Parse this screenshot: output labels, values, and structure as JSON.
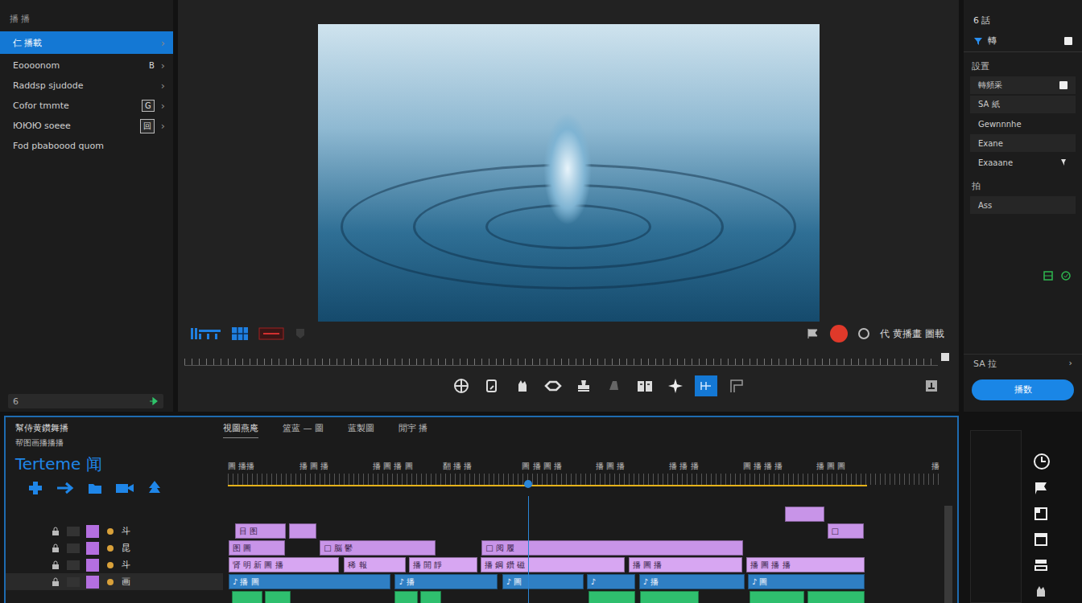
{
  "left_panel": {
    "header": "播  播",
    "items": [
      {
        "label": "仁 播載",
        "selected": true,
        "badge": "",
        "boxed": false,
        "arrow": "›"
      },
      {
        "label": "Eoooonom",
        "selected": false,
        "badge": "B",
        "boxed": false,
        "arrow": "›"
      },
      {
        "label": "Raddsp sjudode",
        "selected": false,
        "badge": "",
        "boxed": false,
        "arrow": "›"
      },
      {
        "label": "Cofor tmmte",
        "selected": false,
        "badge": "G",
        "boxed": true,
        "arrow": "›"
      },
      {
        "label": "ЮЮЮ soeee",
        "selected": false,
        "badge": "回",
        "boxed": true,
        "arrow": "›"
      },
      {
        "label": "Fod pbaboood quom",
        "selected": false,
        "badge": "",
        "boxed": false,
        "arrow": ""
      }
    ],
    "search": {
      "value": "6"
    }
  },
  "preview": {
    "status_label": "代 黄播畫 圖載"
  },
  "tools": [
    {
      "selected": false
    },
    {
      "selected": false
    },
    {
      "selected": false
    },
    {
      "selected": false
    },
    {
      "selected": false
    },
    {
      "selected": false
    },
    {
      "selected": false
    },
    {
      "selected": false
    },
    {
      "selected": true
    },
    {
      "selected": false
    }
  ],
  "right_panel": {
    "title": "6 話",
    "subtitle": "轉",
    "section": "設置",
    "fields": [
      {
        "label": "轉頻采",
        "kind": "field"
      },
      {
        "label": "SA 紙",
        "kind": "field"
      },
      {
        "label": "Gewnnnhe",
        "kind": "plain"
      },
      {
        "label": "Exane",
        "kind": "field"
      },
      {
        "label": "Exaaane",
        "kind": "plain"
      }
    ],
    "section2": "拍",
    "value": "Ass",
    "footer_label": "SA 拉",
    "footer_arrow": "›",
    "button": "播数"
  },
  "timeline": {
    "title": "幫侍黄鑽舞播",
    "subtitle": "帮图画播播播",
    "name": "Terteme 闻",
    "tabs": [
      {
        "label": "視圖燕庵",
        "selected": true
      },
      {
        "label": "篮蓝 — 圖",
        "selected": false
      },
      {
        "label": "蓝製圖",
        "selected": false
      },
      {
        "label": "閒宇 播",
        "selected": false
      }
    ],
    "ruler": {
      "labels": [
        {
          "time": 0,
          "text": "圖 播播"
        },
        {
          "time": 9.7,
          "text": "播 圖 播"
        },
        {
          "time": 19.7,
          "text": "播 圖 播 圖"
        },
        {
          "time": 29.2,
          "text": "翻 播 播"
        },
        {
          "time": 40,
          "text": "圖 播 圖 播"
        },
        {
          "time": 50,
          "text": "播 圖 播"
        },
        {
          "time": 60,
          "text": "播 播 播"
        },
        {
          "time": 70,
          "text": "圖 播 播 播"
        },
        {
          "time": 80,
          "text": "播 圖 圖"
        }
      ],
      "end_label": "播"
    },
    "playhead": 40.8,
    "work_area": {
      "start": 0,
      "end": 86.9
    },
    "tracks": [
      {
        "name": "",
        "selected": false,
        "color": "#c894e8",
        "clips": [
          {
            "start": 75.7,
            "length": 5.6,
            "label": ""
          }
        ]
      },
      {
        "name": "斗",
        "selected": false,
        "color": "#c894e8",
        "clips": [
          {
            "start": 1.0,
            "length": 7.1,
            "label": "目 图"
          },
          {
            "start": 8.3,
            "length": 4.0,
            "label": ""
          },
          {
            "start": 81.5,
            "length": 5.2,
            "label": "□"
          }
        ]
      },
      {
        "name": "昆",
        "selected": false,
        "color": "#c894e8",
        "clips": [
          {
            "start": 0.1,
            "length": 7.9,
            "label": "图 圖"
          },
          {
            "start": 12.5,
            "length": 16.0,
            "label": "□ 脳 鬱"
          },
          {
            "start": 34.5,
            "length": 35.8,
            "label": "□ 阅 履"
          }
        ]
      },
      {
        "name": "斗",
        "selected": false,
        "color": "#d7a6f2",
        "clips": [
          {
            "start": 0.1,
            "length": 15.2,
            "label": "肾 明 新 圖 播"
          },
          {
            "start": 15.8,
            "length": 8.6,
            "label": "稀 報"
          },
          {
            "start": 24.6,
            "length": 9.6,
            "label": "播 開 靜"
          },
          {
            "start": 34.4,
            "length": 19.8,
            "label": "播 鋼 鑽 磁"
          },
          {
            "start": 54.5,
            "length": 15.7,
            "label": "播 圖 播"
          },
          {
            "start": 70.5,
            "length": 16.3,
            "label": "播 圖 播 播"
          }
        ]
      },
      {
        "name": "画",
        "selected": true,
        "color": "#2f7fc4",
        "clips": [
          {
            "start": 0.1,
            "length": 22.2,
            "label": "♪ 播 圖"
          },
          {
            "start": 22.7,
            "length": 14.2,
            "label": "♪ 播"
          },
          {
            "start": 37.3,
            "length": 11.3,
            "label": "♪ 圖"
          },
          {
            "start": 48.8,
            "length": 6.8,
            "label": "♪"
          },
          {
            "start": 55.9,
            "length": 14.6,
            "label": "♪ 播"
          },
          {
            "start": 70.7,
            "length": 16.1,
            "label": "♪ 圖"
          }
        ]
      },
      {
        "name": "",
        "selected": false,
        "color": "#2fbf6e",
        "clips": [
          {
            "start": 0.6,
            "length": 4.3,
            "label": ""
          },
          {
            "start": 5.0,
            "length": 3.8,
            "label": ""
          },
          {
            "start": 22.7,
            "length": 3.3,
            "label": ""
          },
          {
            "start": 26.2,
            "length": 3.0,
            "label": ""
          },
          {
            "start": 49.0,
            "length": 6.6,
            "label": ""
          },
          {
            "start": 56.0,
            "length": 8.2,
            "label": ""
          },
          {
            "start": 70.9,
            "length": 7.7,
            "label": ""
          },
          {
            "start": 78.8,
            "length": 8.0,
            "label": ""
          }
        ]
      }
    ]
  }
}
